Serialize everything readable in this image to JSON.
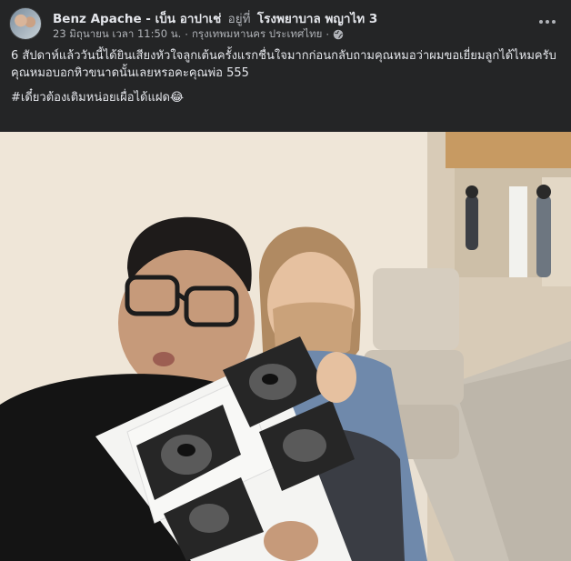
{
  "post": {
    "author": "Benz Apache - เบ็น อาปาเช่",
    "at_word": "อยู่ที่",
    "place": "โรงพยาบาล พญาไท 3",
    "date": "23 มิถุนายน เวลา 11:50 น.",
    "separator": "·",
    "location": "กรุงเทพมหานคร ประเทศไทย",
    "separator2": "·",
    "privacy_icon": "globe-icon",
    "more_icon": "more-horizontal-icon",
    "caption_line1": "6 สัปดาห์แล้ววันนี้ได้ยินเสียงหัวใจลูกเต้นครั้งแรกชื่นใจมากก่อนกลับถามคุณหมอว่าผมขอเยี่ยมลูกได้ไหมครับ",
    "caption_line2": "คุณหมอบอกหิวขนาดนั้นเลยหรอคะคุณพ่อ 555",
    "hashtag": "#เดี๋ยวต้องเติมหน่อยเผื่อได้แฝด😂"
  },
  "colors": {
    "background": "#242526",
    "text_primary": "#e4e6eb",
    "text_secondary": "#b0b3b8"
  }
}
